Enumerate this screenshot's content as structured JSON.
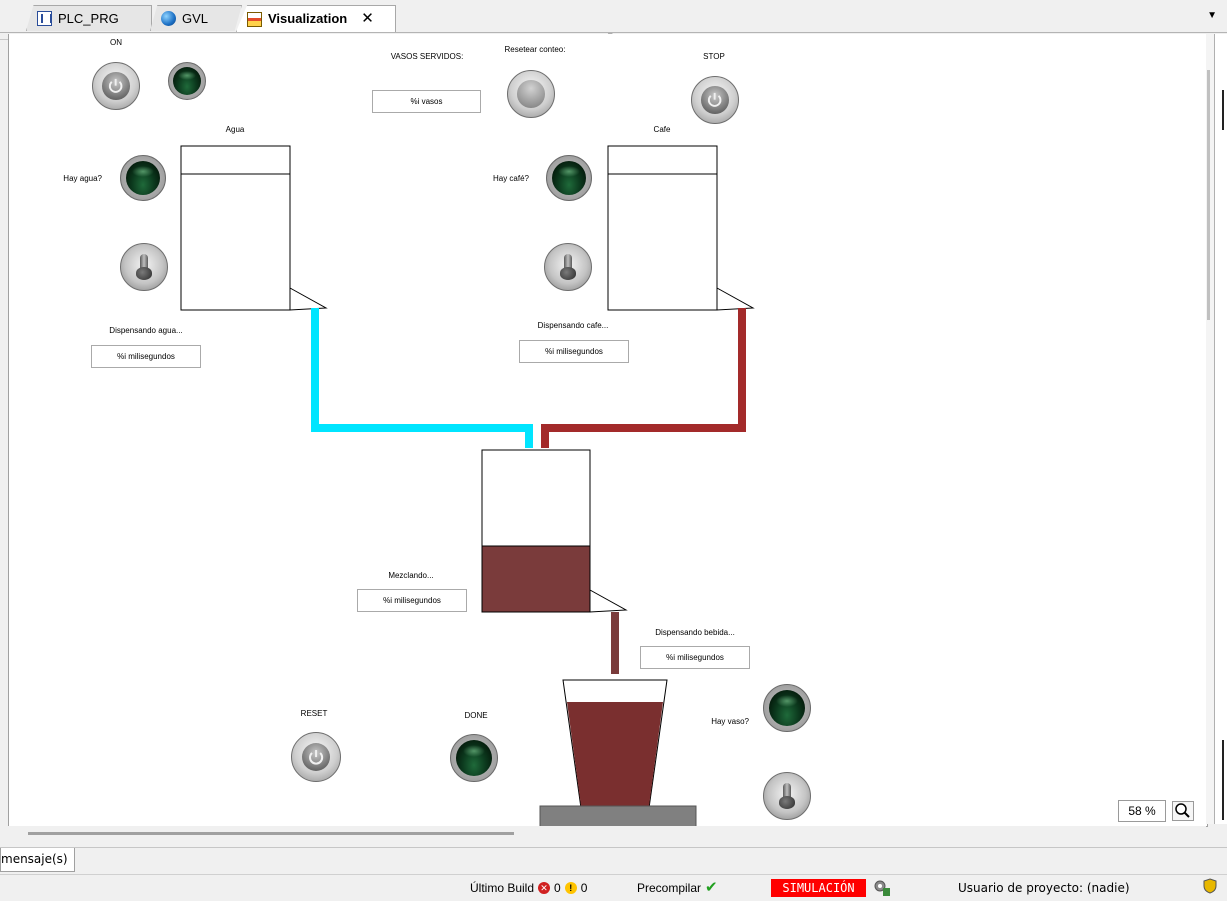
{
  "tabs": [
    {
      "label": "PLC_PRG",
      "icon": "plc-prg-icon"
    },
    {
      "label": "GVL",
      "icon": "gvl-globe-icon"
    },
    {
      "label": "Visualization",
      "icon": "visualization-icon",
      "active": true
    }
  ],
  "visu": {
    "on_label": "ON",
    "stop_label": "STOP",
    "vasos_label": "VASOS SERVIDOS:",
    "vasos_value": "%i vasos",
    "reset_count_label": "Resetear conteo:",
    "agua_label": "Agua",
    "cafe_label": "Cafe",
    "hay_agua_label": "Hay agua?",
    "hay_cafe_label": "Hay café?",
    "disp_agua_label": "Dispensando agua...",
    "disp_agua_value": "%i milisegundos",
    "disp_cafe_label": "Dispensando cafe...",
    "disp_cafe_value": "%i milisegundos",
    "mezclando_label": "Mezclando...",
    "mezclando_value": "%i milisegundos",
    "disp_bebida_label": "Dispensando bebida...",
    "disp_bebida_value": "%i milisegundos",
    "reset_label": "RESET",
    "done_label": "DONE",
    "hay_vaso_label": "Hay vaso?"
  },
  "colors": {
    "water_pipe": "#00e5ff",
    "coffee_pipe": "#a32a2a",
    "mix_fill": "#7a3b3b",
    "cup_fill": "#7a2f2f",
    "lamp_on": "#0c3a1e"
  },
  "zoom": "58 %",
  "messages_tab": "mensaje(s)",
  "status": {
    "build_label": "Último Build",
    "errors": "0",
    "warnings": "0",
    "precompile_label": "Precompilar",
    "simulation": "SIMULACIÓN",
    "user": "Usuario de proyecto: (nadie)"
  }
}
